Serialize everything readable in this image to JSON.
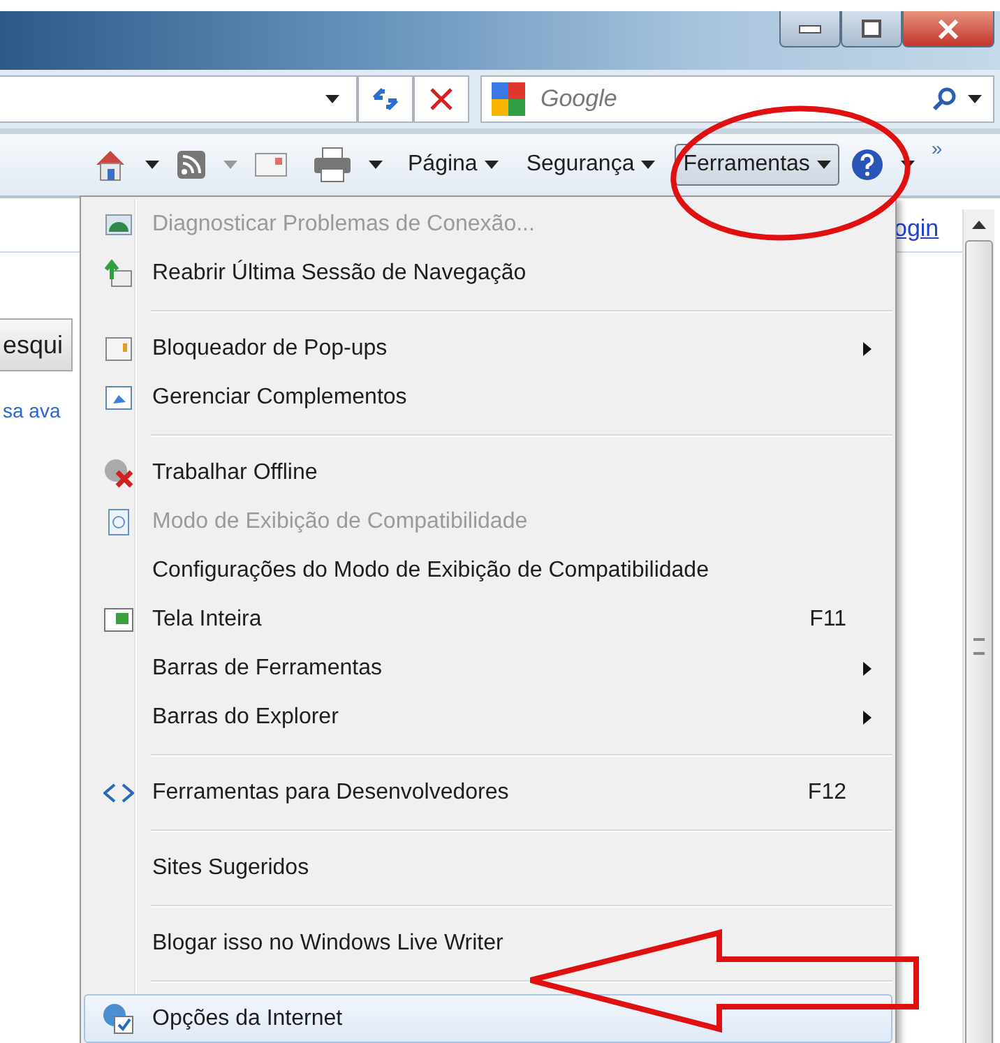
{
  "search": {
    "placeholder": "Google"
  },
  "command_bar": {
    "items": [
      {
        "label": "Página",
        "selected": false
      },
      {
        "label": "Segurança",
        "selected": false
      },
      {
        "label": "Ferramentas",
        "selected": true
      }
    ],
    "overflow": "»"
  },
  "page": {
    "button_text": "esqui",
    "link_text": "sa ava",
    "login_link": "ogin"
  },
  "menu": {
    "items": [
      {
        "kind": "command",
        "label": "Diagnosticar Problemas de Conexão...",
        "disabled": true,
        "submenu": false,
        "selected": false
      },
      {
        "kind": "command",
        "label": "Reabrir Última Sessão de Navegação",
        "disabled": false,
        "submenu": false,
        "selected": false
      },
      {
        "kind": "separator"
      },
      {
        "kind": "command",
        "label": "Bloqueador de Pop-ups",
        "disabled": false,
        "submenu": true,
        "selected": false
      },
      {
        "kind": "command",
        "label": "Gerenciar Complementos",
        "disabled": false,
        "submenu": false,
        "selected": false
      },
      {
        "kind": "separator"
      },
      {
        "kind": "command",
        "label": "Trabalhar Offline",
        "disabled": false,
        "submenu": false,
        "selected": false
      },
      {
        "kind": "command",
        "label": "Modo de Exibição de Compatibilidade",
        "disabled": true,
        "submenu": false,
        "selected": false
      },
      {
        "kind": "command",
        "label": "Configurações do Modo de Exibição de Compatibilidade",
        "disabled": false,
        "submenu": false,
        "selected": false
      },
      {
        "kind": "command",
        "label": "Tela Inteira",
        "shortcut": "F11",
        "disabled": false,
        "submenu": false,
        "selected": false
      },
      {
        "kind": "command",
        "label": "Barras de Ferramentas",
        "disabled": false,
        "submenu": true,
        "selected": false
      },
      {
        "kind": "command",
        "label": "Barras do Explorer",
        "disabled": false,
        "submenu": true,
        "selected": false
      },
      {
        "kind": "separator"
      },
      {
        "kind": "command",
        "label": "Ferramentas para Desenvolvedores",
        "shortcut": "F12",
        "disabled": false,
        "submenu": false,
        "selected": false
      },
      {
        "kind": "separator"
      },
      {
        "kind": "command",
        "label": "Sites Sugeridos",
        "disabled": false,
        "submenu": false,
        "selected": false
      },
      {
        "kind": "separator"
      },
      {
        "kind": "command",
        "label": "Blogar isso no Windows Live Writer",
        "disabled": false,
        "submenu": false,
        "selected": false
      },
      {
        "kind": "separator"
      },
      {
        "kind": "command",
        "label": "Opções da Internet",
        "disabled": false,
        "submenu": false,
        "selected": true
      }
    ]
  },
  "annotations": {
    "highlight_ellipse": true,
    "pointer_arrow": true
  }
}
